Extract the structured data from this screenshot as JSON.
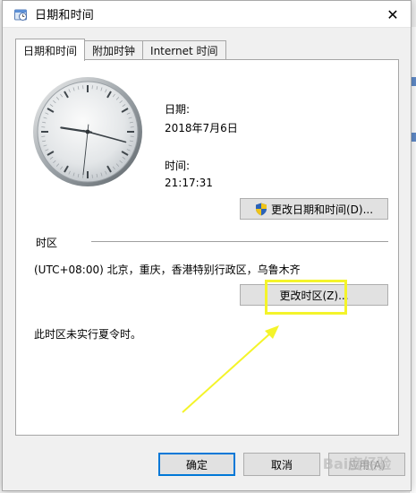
{
  "window": {
    "title": "日期和时间",
    "close_glyph": "✕"
  },
  "tabs": [
    {
      "label": "日期和时间"
    },
    {
      "label": "附加时钟"
    },
    {
      "label": "Internet 时间"
    }
  ],
  "datetime": {
    "date_label": "日期:",
    "date_value": "2018年7月6日",
    "time_label": "时间:",
    "time_value": "21:17:31",
    "change_datetime_button": "更改日期和时间(D)..."
  },
  "timezone": {
    "section_label": "时区",
    "value": "(UTC+08:00) 北京，重庆，香港特别行政区，乌鲁木齐",
    "change_button": "更改时区(Z)...",
    "dst_note": "此时区未实行夏令时。"
  },
  "footer": {
    "ok_button": "确定",
    "cancel_button": "取消",
    "apply_button": "应用(A)"
  },
  "watermark": {
    "text": "Bai度经验"
  },
  "clock": {
    "hours": 21,
    "minutes": 17,
    "seconds": 31
  },
  "colors": {
    "highlight": "#f4f42a",
    "accent": "#0078d7",
    "uac_shield_blue": "#2a62b8",
    "uac_shield_yellow": "#f0c419"
  },
  "icons": {
    "title": "clock-icon",
    "change_datetime": "uac-shield-icon"
  }
}
